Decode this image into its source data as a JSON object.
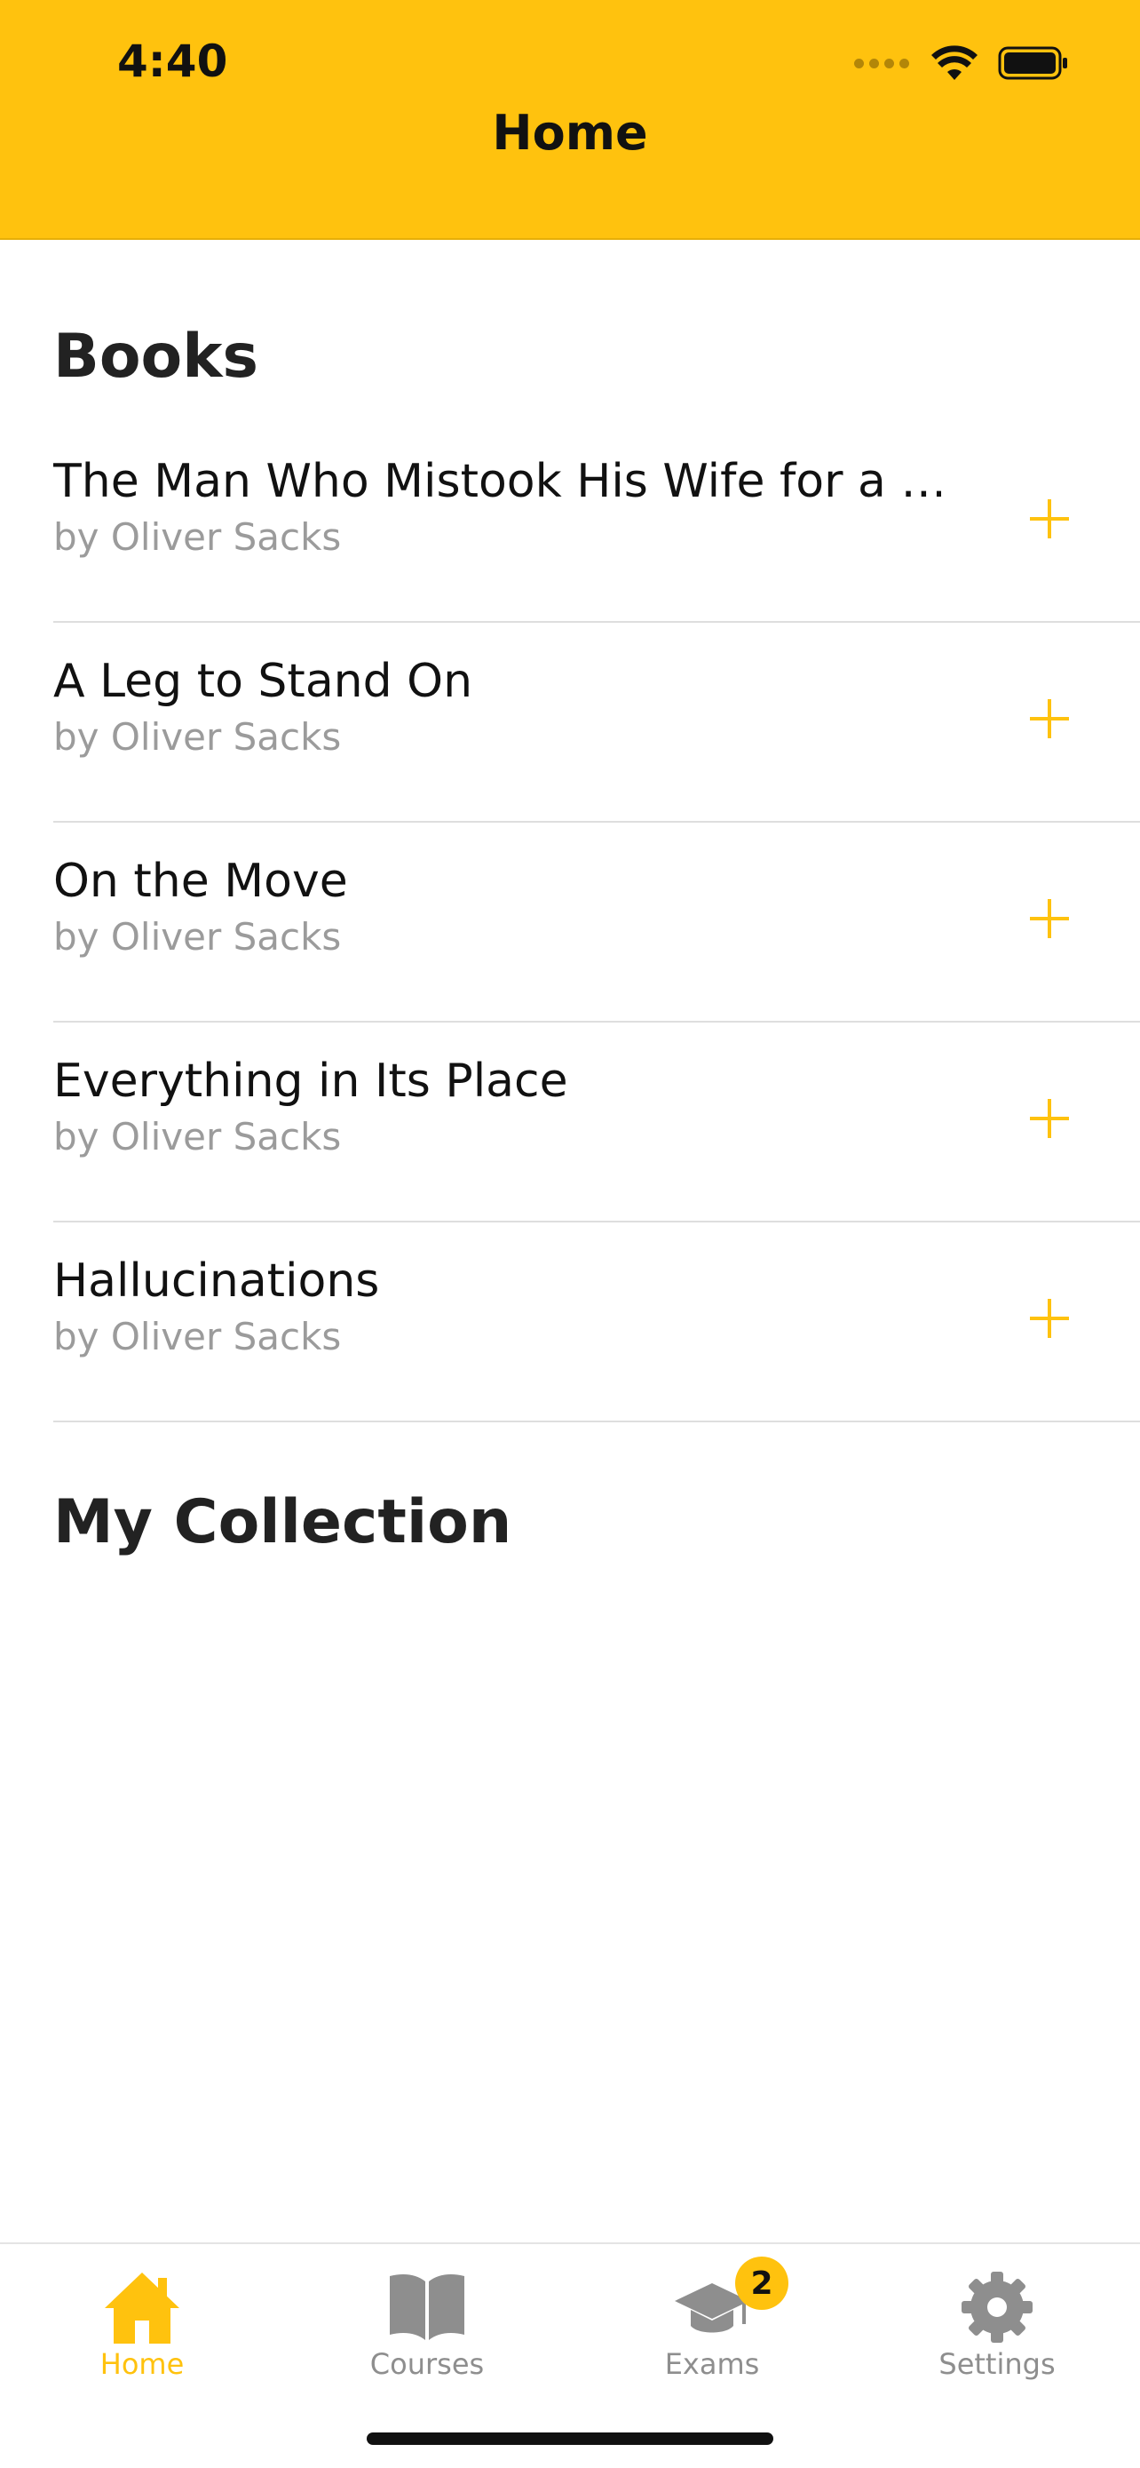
{
  "status_bar": {
    "time": "4:40",
    "signal_icon": "cellular-dots-icon",
    "wifi_icon": "wifi-icon",
    "battery_icon": "battery-full-icon"
  },
  "header": {
    "title": "Home",
    "background_color": "#ffc20e"
  },
  "books_section": {
    "title": "Books",
    "items": [
      {
        "title": "The Man Who Mistook His Wife for a …",
        "author": "by Oliver Sacks",
        "action_icon": "plus-icon"
      },
      {
        "title": "A Leg to Stand On",
        "author": "by Oliver Sacks",
        "action_icon": "plus-icon"
      },
      {
        "title": "On the Move",
        "author": "by Oliver Sacks",
        "action_icon": "plus-icon"
      },
      {
        "title": "Everything in Its Place",
        "author": "by Oliver Sacks",
        "action_icon": "plus-icon"
      },
      {
        "title": "Hallucinations",
        "author": "by Oliver Sacks",
        "action_icon": "plus-icon"
      }
    ]
  },
  "collection_section": {
    "title": "My Collection"
  },
  "tabbar": {
    "active_color": "#ffc20e",
    "inactive_color": "#8e8e8e",
    "tabs": [
      {
        "label": "Home",
        "icon": "house-icon",
        "active": true
      },
      {
        "label": "Courses",
        "icon": "open-book-icon",
        "active": false
      },
      {
        "label": "Exams",
        "icon": "graduation-cap-icon",
        "active": false,
        "badge": "2"
      },
      {
        "label": "Settings",
        "icon": "gear-icon",
        "active": false
      }
    ]
  }
}
